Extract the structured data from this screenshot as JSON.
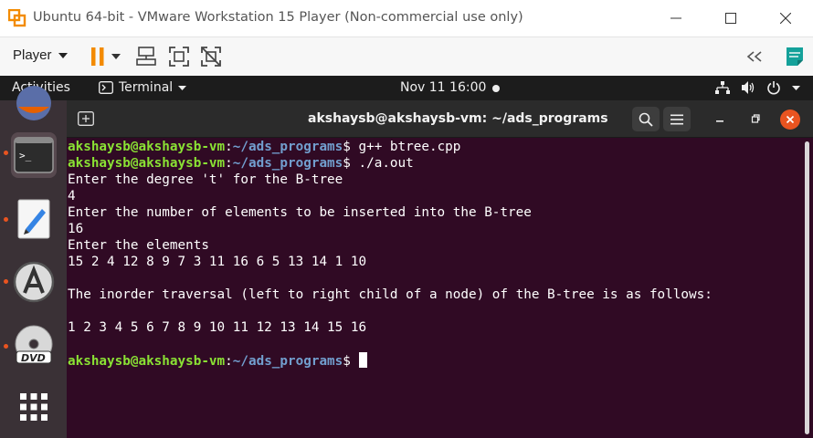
{
  "window": {
    "title": "Ubuntu 64-bit - VMware Workstation 15 Player (Non-commercial use only)"
  },
  "toolbar": {
    "player_label": "Player"
  },
  "gnome": {
    "activities": "Activities",
    "app_name": "Terminal",
    "clock": "Nov 11  16:00"
  },
  "terminal": {
    "title": "akshaysb@akshaysb-vm: ~/ads_programs",
    "prompt_user": "akshaysb@akshaysb-vm",
    "prompt_sep": ":",
    "prompt_path": "~/ads_programs",
    "prompt_symbol": "$ ",
    "lines": [
      {
        "type": "cmd",
        "text": "g++ btree.cpp"
      },
      {
        "type": "cmd",
        "text": "./a.out"
      },
      {
        "type": "out",
        "text": "Enter the degree 't' for the B-tree"
      },
      {
        "type": "out",
        "text": "4"
      },
      {
        "type": "out",
        "text": "Enter the number of elements to be inserted into the B-tree"
      },
      {
        "type": "out",
        "text": "16"
      },
      {
        "type": "out",
        "text": "Enter the elements"
      },
      {
        "type": "out",
        "text": "15 2 4 12 8 9 7 3 11 16 6 5 13 14 1 10"
      },
      {
        "type": "out",
        "text": ""
      },
      {
        "type": "out",
        "text": "The inorder traversal (left to right child of a node) of the B-tree is as follows:"
      },
      {
        "type": "out",
        "text": ""
      },
      {
        "type": "out",
        "text": "1 2 3 4 5 6 7 8 9 10 11 12 13 14 15 16"
      },
      {
        "type": "out",
        "text": ""
      },
      {
        "type": "cmd",
        "text": ""
      }
    ]
  },
  "colors": {
    "terminal_bg": "#300a24",
    "prompt_user": "#8ae234",
    "prompt_path": "#729fcf",
    "ubuntu_orange": "#e95420",
    "vmware_orange": "#f38b00"
  }
}
